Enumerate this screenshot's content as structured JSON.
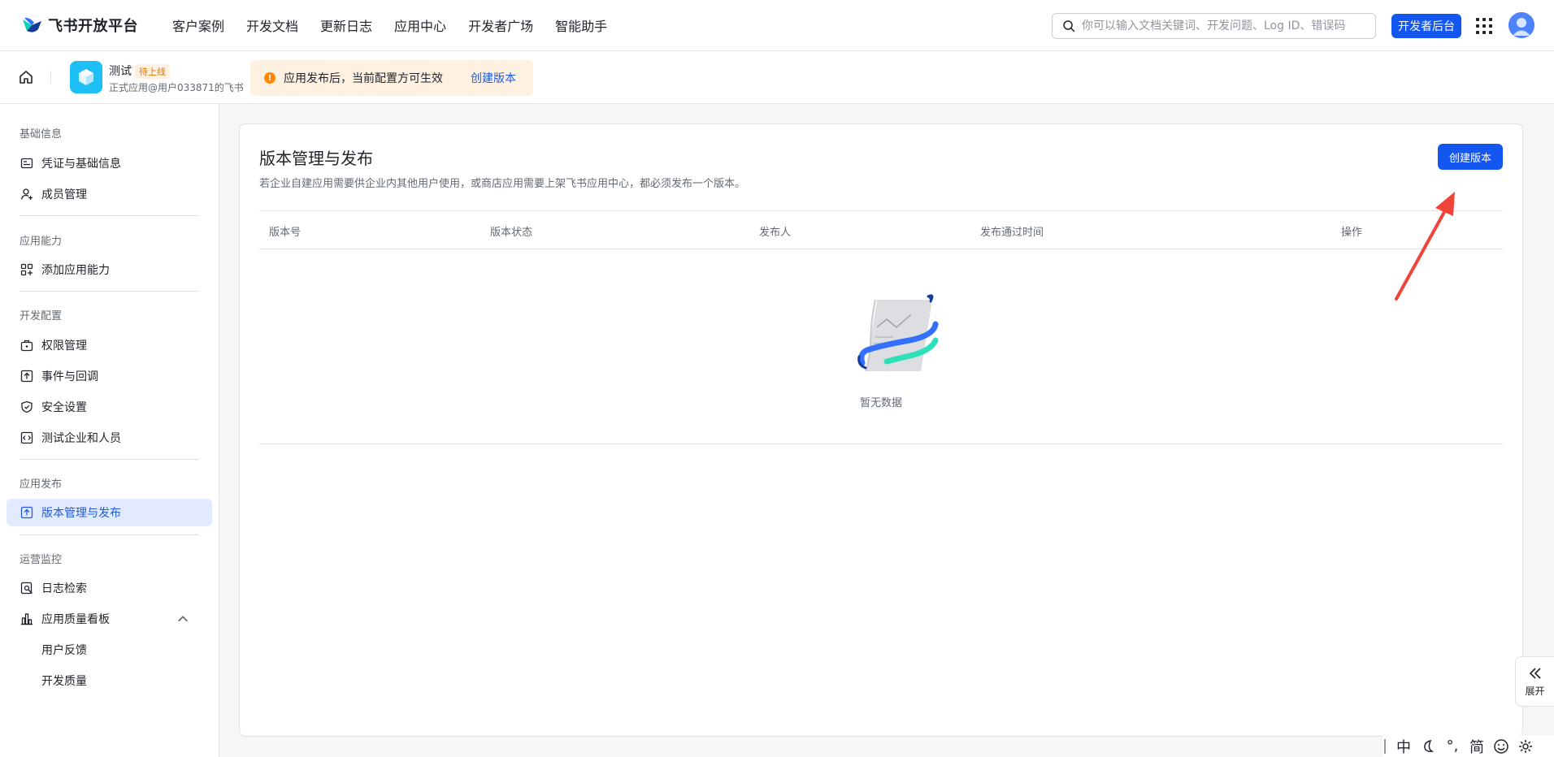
{
  "topnav": {
    "logo_text": "飞书开放平台",
    "links": [
      "客户案例",
      "开发文档",
      "更新日志",
      "应用中心",
      "开发者广场",
      "智能助手"
    ],
    "search_placeholder": "你可以输入文档关键词、开发问题、Log ID、错误码",
    "dev_button": "开发者后台"
  },
  "subheader": {
    "app_name": "测试",
    "app_badge": "待上线",
    "app_subtitle": "正式应用@用户033871的飞书",
    "notice_text": "应用发布后，当前配置方可生效",
    "notice_link": "创建版本"
  },
  "sidebar": {
    "sections": [
      {
        "title": "基础信息",
        "items": [
          "凭证与基础信息",
          "成员管理"
        ]
      },
      {
        "title": "应用能力",
        "items": [
          "添加应用能力"
        ]
      },
      {
        "title": "开发配置",
        "items": [
          "权限管理",
          "事件与回调",
          "安全设置",
          "测试企业和人员"
        ]
      },
      {
        "title": "应用发布",
        "items": [
          "版本管理与发布"
        ]
      },
      {
        "title": "运营监控",
        "items": [
          "日志检索",
          "应用质量看板"
        ],
        "subitems": [
          "用户反馈",
          "开发质量"
        ]
      }
    ]
  },
  "main": {
    "title": "版本管理与发布",
    "description": "若企业自建应用需要供企业内其他用户使用，或商店应用需要上架飞书应用中心，都必须发布一个版本。",
    "create_button": "创建版本",
    "columns": [
      "版本号",
      "版本状态",
      "发布人",
      "发布通过时间",
      "操作"
    ],
    "empty_text": "暂无数据"
  },
  "expand_tab": {
    "label": "展开"
  },
  "ime": {
    "items": [
      "中",
      "°,",
      "简"
    ]
  },
  "colors": {
    "primary": "#1456f0",
    "active_bg": "#e1eaff",
    "notice_bg": "#fef1e1",
    "warn": "#ff8800",
    "arrow": "#f0433a"
  }
}
